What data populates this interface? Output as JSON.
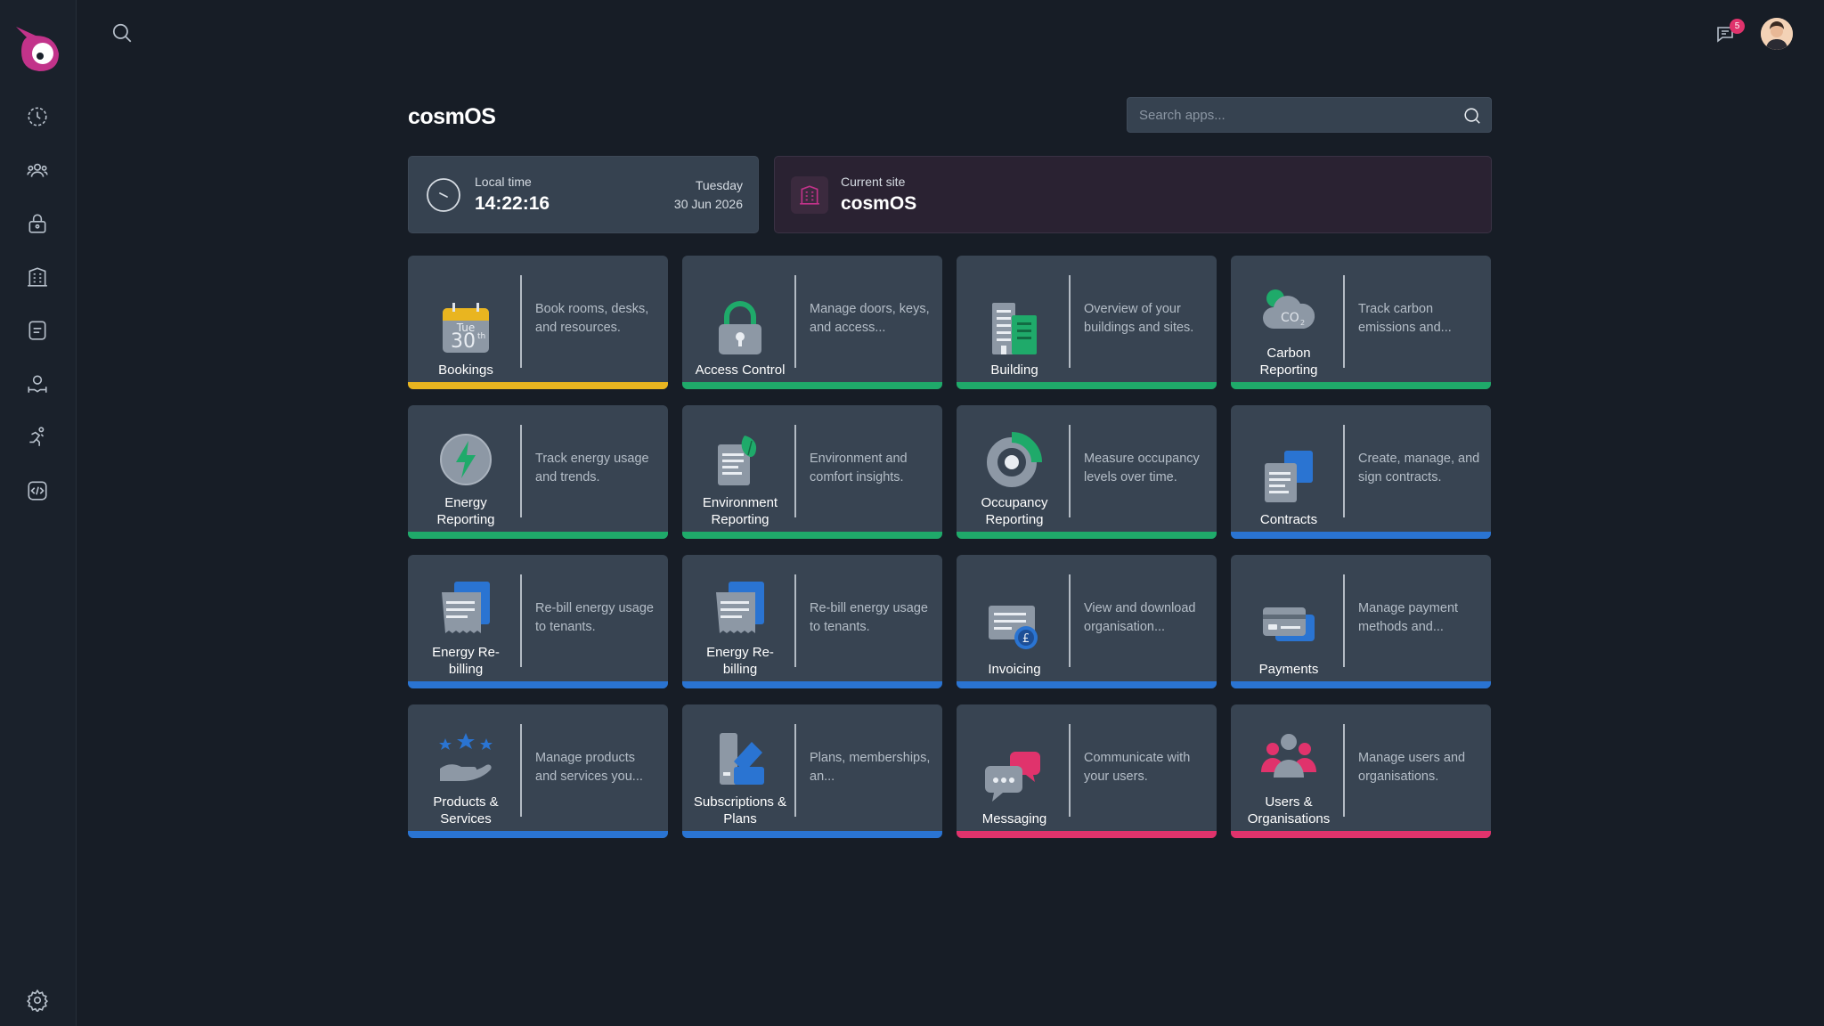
{
  "header": {
    "title": "cosmOS",
    "search_placeholder": "Search apps...",
    "notification_count": "5"
  },
  "sidebar": {
    "items": [
      {
        "name": "history-icon"
      },
      {
        "name": "users-icon"
      },
      {
        "name": "lock-icon"
      },
      {
        "name": "building-icon"
      },
      {
        "name": "document-icon"
      },
      {
        "name": "support-icon"
      },
      {
        "name": "activity-icon"
      },
      {
        "name": "code-icon"
      }
    ],
    "settings_icon": "gear-icon"
  },
  "time_card": {
    "label": "Local time",
    "time": "14:22:16",
    "day": "Tuesday",
    "date": "30 Jun 2026"
  },
  "site_card": {
    "label": "Current site",
    "site": "cosmOS"
  },
  "calendar_icon": {
    "day": "Tue",
    "date": "30",
    "suffix": "th"
  },
  "colors": {
    "yellow": "#e9b520",
    "green": "#1faa6a",
    "blue": "#2a74d2",
    "pink": "#e0336c"
  },
  "apps": [
    {
      "name": "Bookings",
      "desc": "Book rooms, desks, and resources.",
      "bar": "yellow",
      "icon": "calendar-icon"
    },
    {
      "name": "Access Control",
      "desc": "Manage doors, keys, and access...",
      "bar": "green",
      "icon": "padlock-icon"
    },
    {
      "name": "Building",
      "desc": "Overview of your buildings and sites.",
      "bar": "green",
      "icon": "building-icon"
    },
    {
      "name": "Carbon Reporting",
      "desc": "Track carbon emissions and...",
      "bar": "green",
      "icon": "cloud-co2-icon"
    },
    {
      "name": "Energy Reporting",
      "desc": "Track energy usage and trends.",
      "bar": "green",
      "icon": "lightning-icon"
    },
    {
      "name": "Environment Reporting",
      "desc": "Environment and comfort insights.",
      "bar": "green",
      "icon": "leaf-document-icon"
    },
    {
      "name": "Occupancy Reporting",
      "desc": "Measure occupancy levels over time.",
      "bar": "green",
      "icon": "donut-chart-icon"
    },
    {
      "name": "Contracts",
      "desc": "Create, manage, and sign contracts.",
      "bar": "blue",
      "icon": "contract-icon"
    },
    {
      "name": "Energy Re-billing",
      "desc": "Re-bill energy usage to tenants.",
      "bar": "blue",
      "icon": "receipt-icon"
    },
    {
      "name": "Energy Re-billing",
      "desc": "Re-bill energy usage to tenants.",
      "bar": "blue",
      "icon": "receipt-icon"
    },
    {
      "name": "Invoicing",
      "desc": "View and download organisation...",
      "bar": "blue",
      "icon": "invoice-icon"
    },
    {
      "name": "Payments",
      "desc": "Manage payment methods and...",
      "bar": "blue",
      "icon": "card-icon"
    },
    {
      "name": "Products & Services",
      "desc": "Manage products and services you...",
      "bar": "blue",
      "icon": "hand-stars-icon"
    },
    {
      "name": "Subscriptions & Plans",
      "desc": "Plans, memberships, an...",
      "bar": "blue",
      "icon": "subscription-icon"
    },
    {
      "name": "Messaging",
      "desc": "Communicate with your users.",
      "bar": "pink",
      "icon": "chat-bubbles-icon"
    },
    {
      "name": "Users & Organisations",
      "desc": "Manage users and organisations.",
      "bar": "pink",
      "icon": "people-icon"
    }
  ]
}
